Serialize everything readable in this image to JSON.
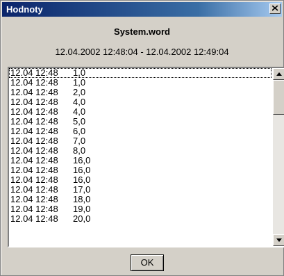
{
  "window": {
    "title": "Hodnoty"
  },
  "heading": "System.word",
  "time_range": "12.04.2002 12:48:04 - 12.04.2002 12:49:04",
  "list": {
    "rows": [
      {
        "date": "12.04 12:48",
        "value": "1,0"
      },
      {
        "date": "12.04 12:48",
        "value": "1,0"
      },
      {
        "date": "12.04 12:48",
        "value": "2,0"
      },
      {
        "date": "12.04 12:48",
        "value": "4,0"
      },
      {
        "date": "12.04 12:48",
        "value": "4,0"
      },
      {
        "date": "12.04 12:48",
        "value": "5,0"
      },
      {
        "date": "12.04 12:48",
        "value": "6,0"
      },
      {
        "date": "12.04 12:48",
        "value": "7,0"
      },
      {
        "date": "12.04 12:48",
        "value": "8,0"
      },
      {
        "date": "12.04 12:48",
        "value": "16,0"
      },
      {
        "date": "12.04 12:48",
        "value": "16,0"
      },
      {
        "date": "12.04 12:48",
        "value": "16,0"
      },
      {
        "date": "12.04 12:48",
        "value": "17,0"
      },
      {
        "date": "12.04 12:48",
        "value": "18,0"
      },
      {
        "date": "12.04 12:48",
        "value": "19,0"
      },
      {
        "date": "12.04 12:48",
        "value": "20,0"
      }
    ]
  },
  "buttons": {
    "ok": "OK"
  },
  "icons": {
    "close": "close-icon",
    "scroll_up": "arrow-up-icon",
    "scroll_down": "arrow-down-icon"
  },
  "colors": {
    "titlebar_start": "#0a246a",
    "titlebar_end": "#a6caf0",
    "face": "#d4d0c8"
  }
}
